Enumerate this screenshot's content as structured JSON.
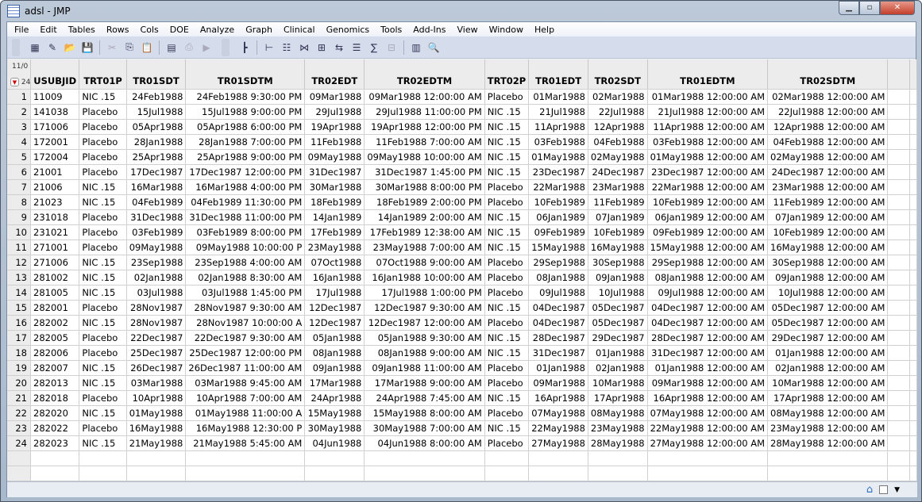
{
  "window": {
    "title": "adsl - JMP"
  },
  "menu": [
    "File",
    "Edit",
    "Tables",
    "Rows",
    "Cols",
    "DOE",
    "Analyze",
    "Graph",
    "Clinical",
    "Genomics",
    "Tools",
    "Add-Ins",
    "View",
    "Window",
    "Help"
  ],
  "toolbar": [
    "new-data-table",
    "new-script",
    "open",
    "save",
    "cut",
    "copy",
    "paste",
    "data-table",
    "pdf",
    "run-script",
    "tree",
    "split",
    "stack",
    "join",
    "concatenate",
    "update",
    "tabulate",
    "summary",
    "subset",
    "columns-viewer",
    "distribution-viewer"
  ],
  "table": {
    "col_count_label": "11/0",
    "row_count_label": "24/0",
    "columns": [
      "USUBJID",
      "TRT01P",
      "TR01SDT",
      "TR01SDTM",
      "TR02EDT",
      "TR02EDTM",
      "TRT02P",
      "TR01EDT",
      "TR02SDT",
      "TR01EDTM",
      "TR02SDTM"
    ],
    "rows": [
      [
        "11009",
        "NIC .15",
        "24Feb1988",
        "24Feb1988 9:30:00 PM",
        "09Mar1988",
        "09Mar1988 12:00:00 AM",
        "Placebo",
        "01Mar1988",
        "02Mar1988",
        "01Mar1988 12:00:00 AM",
        "02Mar1988 12:00:00 AM"
      ],
      [
        "141038",
        "Placebo",
        "15Jul1988",
        "15Jul1988 9:00:00 PM",
        "29Jul1988",
        "29Jul1988 11:00:00 PM",
        "NIC .15",
        "21Jul1988",
        "22Jul1988",
        "21Jul1988 12:00:00 AM",
        "22Jul1988 12:00:00 AM"
      ],
      [
        "171006",
        "Placebo",
        "05Apr1988",
        "05Apr1988 6:00:00 PM",
        "19Apr1988",
        "19Apr1988 12:00:00 PM",
        "NIC .15",
        "11Apr1988",
        "12Apr1988",
        "11Apr1988 12:00:00 AM",
        "12Apr1988 12:00:00 AM"
      ],
      [
        "172001",
        "Placebo",
        "28Jan1988",
        "28Jan1988 7:00:00 PM",
        "11Feb1988",
        "11Feb1988 7:00:00 AM",
        "NIC .15",
        "03Feb1988",
        "04Feb1988",
        "03Feb1988 12:00:00 AM",
        "04Feb1988 12:00:00 AM"
      ],
      [
        "172004",
        "Placebo",
        "25Apr1988",
        "25Apr1988 9:00:00 PM",
        "09May1988",
        "09May1988 10:00:00 AM",
        "NIC .15",
        "01May1988",
        "02May1988",
        "01May1988 12:00:00 AM",
        "02May1988 12:00:00 AM"
      ],
      [
        "21001",
        "Placebo",
        "17Dec1987",
        "17Dec1987 12:00:00 PM",
        "31Dec1987",
        "31Dec1987 1:45:00 PM",
        "NIC .15",
        "23Dec1987",
        "24Dec1987",
        "23Dec1987 12:00:00 AM",
        "24Dec1987 12:00:00 AM"
      ],
      [
        "21006",
        "NIC .15",
        "16Mar1988",
        "16Mar1988 4:00:00 PM",
        "30Mar1988",
        "30Mar1988 8:00:00 PM",
        "Placebo",
        "22Mar1988",
        "23Mar1988",
        "22Mar1988 12:00:00 AM",
        "23Mar1988 12:00:00 AM"
      ],
      [
        "21023",
        "NIC .15",
        "04Feb1989",
        "04Feb1989 11:30:00 PM",
        "18Feb1989",
        "18Feb1989 2:00:00 PM",
        "Placebo",
        "10Feb1989",
        "11Feb1989",
        "10Feb1989 12:00:00 AM",
        "11Feb1989 12:00:00 AM"
      ],
      [
        "231018",
        "Placebo",
        "31Dec1988",
        "31Dec1988 11:00:00 PM",
        "14Jan1989",
        "14Jan1989 2:00:00 AM",
        "NIC .15",
        "06Jan1989",
        "07Jan1989",
        "06Jan1989 12:00:00 AM",
        "07Jan1989 12:00:00 AM"
      ],
      [
        "231021",
        "Placebo",
        "03Feb1989",
        "03Feb1989 8:00:00 PM",
        "17Feb1989",
        "17Feb1989 12:38:00 AM",
        "NIC .15",
        "09Feb1989",
        "10Feb1989",
        "09Feb1989 12:00:00 AM",
        "10Feb1989 12:00:00 AM"
      ],
      [
        "271001",
        "Placebo",
        "09May1988",
        "09May1988 10:00:00 P",
        "23May1988",
        "23May1988 7:00:00 AM",
        "NIC .15",
        "15May1988",
        "16May1988",
        "15May1988 12:00:00 AM",
        "16May1988 12:00:00 AM"
      ],
      [
        "271006",
        "NIC .15",
        "23Sep1988",
        "23Sep1988 4:00:00 AM",
        "07Oct1988",
        "07Oct1988 9:00:00 AM",
        "Placebo",
        "29Sep1988",
        "30Sep1988",
        "29Sep1988 12:00:00 AM",
        "30Sep1988 12:00:00 AM"
      ],
      [
        "281002",
        "NIC .15",
        "02Jan1988",
        "02Jan1988 8:30:00 AM",
        "16Jan1988",
        "16Jan1988 10:00:00 AM",
        "Placebo",
        "08Jan1988",
        "09Jan1988",
        "08Jan1988 12:00:00 AM",
        "09Jan1988 12:00:00 AM"
      ],
      [
        "281005",
        "NIC .15",
        "03Jul1988",
        "03Jul1988 1:45:00 PM",
        "17Jul1988",
        "17Jul1988 1:00:00 PM",
        "Placebo",
        "09Jul1988",
        "10Jul1988",
        "09Jul1988 12:00:00 AM",
        "10Jul1988 12:00:00 AM"
      ],
      [
        "282001",
        "Placebo",
        "28Nov1987",
        "28Nov1987 9:30:00 AM",
        "12Dec1987",
        "12Dec1987 9:30:00 AM",
        "NIC .15",
        "04Dec1987",
        "05Dec1987",
        "04Dec1987 12:00:00 AM",
        "05Dec1987 12:00:00 AM"
      ],
      [
        "282002",
        "NIC .15",
        "28Nov1987",
        "28Nov1987 10:00:00 A",
        "12Dec1987",
        "12Dec1987 12:00:00 AM",
        "Placebo",
        "04Dec1987",
        "05Dec1987",
        "04Dec1987 12:00:00 AM",
        "05Dec1987 12:00:00 AM"
      ],
      [
        "282005",
        "Placebo",
        "22Dec1987",
        "22Dec1987 9:30:00 AM",
        "05Jan1988",
        "05Jan1988 9:30:00 AM",
        "NIC .15",
        "28Dec1987",
        "29Dec1987",
        "28Dec1987 12:00:00 AM",
        "29Dec1987 12:00:00 AM"
      ],
      [
        "282006",
        "Placebo",
        "25Dec1987",
        "25Dec1987 12:00:00 PM",
        "08Jan1988",
        "08Jan1988 9:00:00 AM",
        "NIC .15",
        "31Dec1987",
        "01Jan1988",
        "31Dec1987 12:00:00 AM",
        "01Jan1988 12:00:00 AM"
      ],
      [
        "282007",
        "NIC .15",
        "26Dec1987",
        "26Dec1987 11:00:00 AM",
        "09Jan1988",
        "09Jan1988 11:00:00 AM",
        "Placebo",
        "01Jan1988",
        "02Jan1988",
        "01Jan1988 12:00:00 AM",
        "02Jan1988 12:00:00 AM"
      ],
      [
        "282013",
        "NIC .15",
        "03Mar1988",
        "03Mar1988 9:45:00 AM",
        "17Mar1988",
        "17Mar1988 9:00:00 AM",
        "Placebo",
        "09Mar1988",
        "10Mar1988",
        "09Mar1988 12:00:00 AM",
        "10Mar1988 12:00:00 AM"
      ],
      [
        "282018",
        "Placebo",
        "10Apr1988",
        "10Apr1988 7:00:00 AM",
        "24Apr1988",
        "24Apr1988 7:45:00 AM",
        "NIC .15",
        "16Apr1988",
        "17Apr1988",
        "16Apr1988 12:00:00 AM",
        "17Apr1988 12:00:00 AM"
      ],
      [
        "282020",
        "NIC .15",
        "01May1988",
        "01May1988 11:00:00 A",
        "15May1988",
        "15May1988 8:00:00 AM",
        "Placebo",
        "07May1988",
        "08May1988",
        "07May1988 12:00:00 AM",
        "08May1988 12:00:00 AM"
      ],
      [
        "282022",
        "Placebo",
        "16May1988",
        "16May1988 12:30:00 P",
        "30May1988",
        "30May1988 7:00:00 AM",
        "NIC .15",
        "22May1988",
        "23May1988",
        "22May1988 12:00:00 AM",
        "23May1988 12:00:00 AM"
      ],
      [
        "282023",
        "NIC .15",
        "21May1988",
        "21May1988 5:45:00 AM",
        "04Jun1988",
        "04Jun1988 8:00:00 AM",
        "Placebo",
        "27May1988",
        "28May1988",
        "27May1988 12:00:00 AM",
        "28May1988 12:00:00 AM"
      ]
    ]
  }
}
